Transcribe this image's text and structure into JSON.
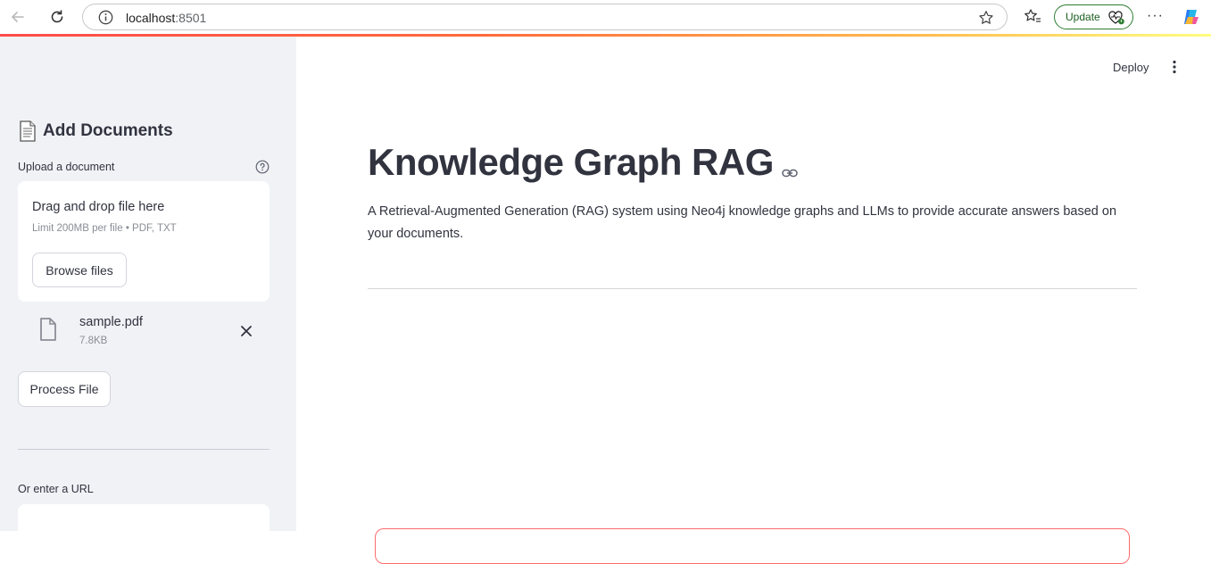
{
  "browser": {
    "url_host": "localhost",
    "url_port": ":8501",
    "update_label": "Update",
    "more_label": "···"
  },
  "header": {
    "deploy_label": "Deploy"
  },
  "sidebar": {
    "title": "Add Documents",
    "upload_label": "Upload a document",
    "dropzone": {
      "title": "Drag and drop file here",
      "limit": "Limit 200MB per file • PDF, TXT",
      "browse_label": "Browse files"
    },
    "uploaded_file": {
      "name": "sample.pdf",
      "size": "7.8KB"
    },
    "process_label": "Process File",
    "url_label": "Or enter a URL",
    "url_value": ""
  },
  "main": {
    "title": "Knowledge Graph RAG",
    "description": "A Retrieval-Augmented Generation (RAG) system using Neo4j knowledge graphs and LLMs to provide accurate answers based on your documents."
  },
  "colors": {
    "accent": "#ff4b4b",
    "sidebar_bg": "#f0f2f6",
    "text": "#31333f",
    "update_green": "#1b5e20"
  }
}
